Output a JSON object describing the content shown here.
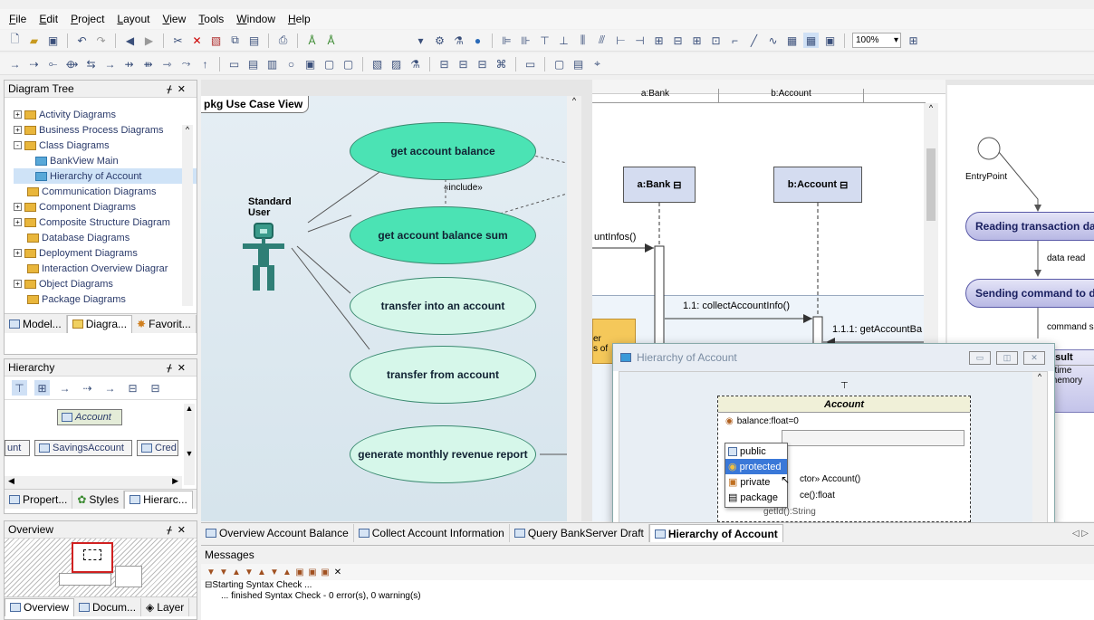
{
  "menu": [
    "File",
    "Edit",
    "Project",
    "Layout",
    "View",
    "Tools",
    "Window",
    "Help"
  ],
  "toolbar": {
    "zoom": "100%"
  },
  "diagram_tree": {
    "title": "Diagram Tree",
    "items": [
      {
        "label": "Activity Diagrams",
        "kind": "folder",
        "exp": "+"
      },
      {
        "label": "Business Process Diagrams",
        "kind": "folder",
        "exp": "+"
      },
      {
        "label": "Class Diagrams",
        "kind": "folder",
        "exp": "-"
      },
      {
        "label": "BankView Main",
        "kind": "diagram",
        "exp": ""
      },
      {
        "label": "Hierarchy of Account",
        "kind": "diagram",
        "exp": ""
      },
      {
        "label": "Communication Diagrams",
        "kind": "folder",
        "exp": ""
      },
      {
        "label": "Component Diagrams",
        "kind": "folder",
        "exp": "+"
      },
      {
        "label": "Composite Structure Diagram",
        "kind": "folder",
        "exp": "+"
      },
      {
        "label": "Database Diagrams",
        "kind": "folder",
        "exp": ""
      },
      {
        "label": "Deployment Diagrams",
        "kind": "folder",
        "exp": "+"
      },
      {
        "label": "Interaction Overview Diagrar",
        "kind": "folder",
        "exp": ""
      },
      {
        "label": "Object Diagrams",
        "kind": "folder",
        "exp": "+"
      },
      {
        "label": "Package Diagrams",
        "kind": "folder",
        "exp": ""
      }
    ],
    "tabs": [
      "Model...",
      "Diagra...",
      "Favorit..."
    ]
  },
  "hierarchy": {
    "title": "Hierarchy",
    "root": "Account",
    "children": [
      "unt",
      "SavingsAccount",
      "Cred"
    ],
    "tabs": [
      "Propert...",
      "Styles",
      "Hierarc..."
    ]
  },
  "overview": {
    "title": "Overview",
    "tabs": [
      "Overview",
      "Docum...",
      "Layer"
    ]
  },
  "usecase_diagram": {
    "package_label": "pkg Use Case View",
    "actor": "Standard User",
    "use_cases": [
      "get account balance",
      "get account balance sum",
      "transfer into an account",
      "transfer from account",
      "generate monthly revenue report"
    ],
    "include_label": "«include»"
  },
  "sequence_diagram": {
    "header_cols": [
      "a:Bank",
      "b:Account"
    ],
    "lifelines": [
      "a:Bank",
      "b:Account"
    ],
    "messages": [
      "untInfos()",
      "1.1: collectAccountInfo()",
      "1.1.1: getAccountBa"
    ],
    "note_fragment": [
      "er",
      "s of"
    ]
  },
  "activity_diagram": {
    "entry": "EntryPoint",
    "actions": [
      "Reading transaction dat",
      "Sending command to da"
    ],
    "flows": [
      "data read",
      "command s"
    ],
    "partial": [
      "esult",
      "t time",
      "memory"
    ]
  },
  "hierarchy_window": {
    "title": "Hierarchy of Account",
    "class_name": "Account",
    "attribute": "balance:float=0",
    "visibility_options": [
      "public",
      "protected",
      "private",
      "package"
    ],
    "selected_visibility": "protected",
    "op_fragments": [
      "ctor» Account()",
      "ce():float",
      "getId():String"
    ]
  },
  "doc_tabs": [
    "Overview Account Balance",
    "Collect Account Information",
    "Query BankServer Draft",
    "Hierarchy of Account"
  ],
  "active_doc_tab": "Hierarchy of Account",
  "messages": {
    "title": "Messages",
    "lines": [
      "Starting Syntax Check ...",
      "... finished Syntax Check - 0 error(s), 0 warning(s)"
    ]
  },
  "colors": {
    "usecase_fill": "#4be3b4",
    "usecase_light": "#d6f7ea",
    "actor": "#2f7f76",
    "selection": "#3a78d8"
  }
}
